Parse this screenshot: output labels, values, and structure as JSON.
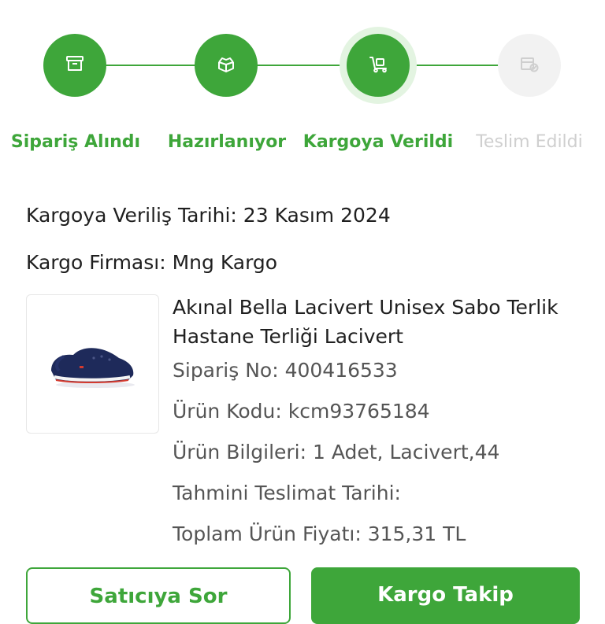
{
  "steps": [
    {
      "label": "Sipariş Alındı",
      "icon": "archive-box-icon",
      "state": "done"
    },
    {
      "label": "Hazırlanıyor",
      "icon": "open-box-icon",
      "state": "done"
    },
    {
      "label": "Kargoya Verildi",
      "icon": "delivery-dolly-icon",
      "state": "current"
    },
    {
      "label": "Teslim Edildi",
      "icon": "delivered-box-icon",
      "state": "pending"
    }
  ],
  "shipment": {
    "date_line": "Kargoya Veriliş Tarihi: 23 Kasım 2024",
    "carrier_line": "Kargo Firması: Mng Kargo"
  },
  "product": {
    "image_icon": "clog-shoe-image",
    "title": "Akınal Bella Lacivert Unisex Sabo Terlik Hastane Terliği Lacivert",
    "order_no": "Sipariş No: 400416533",
    "product_code": "Ürün Kodu: kcm93765184",
    "product_info": "Ürün Bilgileri: 1 Adet, Lacivert,44",
    "estimated_delivery": "Tahmini Teslimat Tarihi:",
    "total_price": "Toplam Ürün Fiyatı: 315,31 TL"
  },
  "actions": {
    "ask_seller": "Satıcıya Sor",
    "track_cargo": "Kargo Takip"
  },
  "colors": {
    "accent": "#3ea63a",
    "accent_light": "#e3f4e1",
    "inactive": "#cfcfcf"
  }
}
